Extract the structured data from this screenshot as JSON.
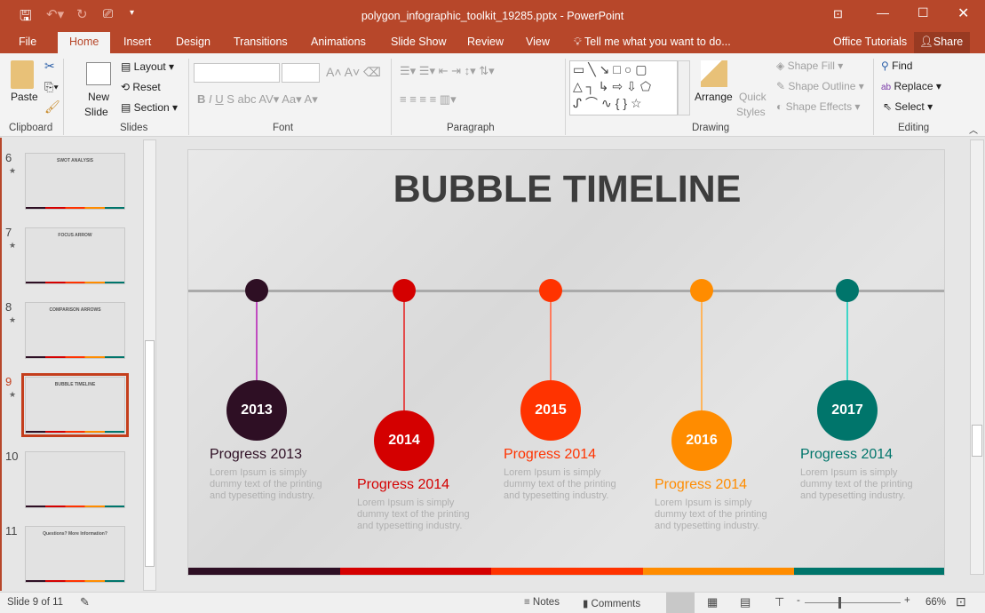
{
  "window": {
    "title": "polygon_infographic_toolkit_19285.pptx - PowerPoint"
  },
  "tabs": [
    "File",
    "Home",
    "Insert",
    "Design",
    "Transitions",
    "Animations",
    "Slide Show",
    "Review",
    "View"
  ],
  "tell_me": "Tell me what you want to do...",
  "account": "Office Tutorials",
  "share": "Share",
  "ribbon": {
    "paste": "Paste",
    "new_slide": "New",
    "new_slide2": "Slide",
    "layout": "Layout",
    "reset": "Reset",
    "section": "Section",
    "groups": [
      "Clipboard",
      "Slides",
      "Font",
      "Paragraph",
      "Drawing",
      "Editing"
    ],
    "arrange": "Arrange",
    "quick_styles": "Quick",
    "quick_styles2": "Styles",
    "shape_fill": "Shape Fill",
    "shape_outline": "Shape Outline",
    "shape_effects": "Shape Effects",
    "find": "Find",
    "replace": "Replace",
    "select": "Select"
  },
  "thumbnails": [
    {
      "num": "6",
      "title": "SWOT ANALYSIS"
    },
    {
      "num": "7",
      "title": "FOCUS ARROW"
    },
    {
      "num": "8",
      "title": "COMPARISON ARROWS"
    },
    {
      "num": "9",
      "title": "BUBBLE TIMELINE"
    },
    {
      "num": "10",
      "title": ""
    },
    {
      "num": "11",
      "title": "Questions? More Information?"
    }
  ],
  "slide": {
    "title": "BUBBLE TIMELINE",
    "items": [
      {
        "year": "2013",
        "heading": "Progress 2013",
        "body": "Lorem Ipsum is simply dummy text of the printing and typesetting industry.",
        "color": "#2e0f24",
        "stem": "#c04cc0"
      },
      {
        "year": "2014",
        "heading": "Progress 2014",
        "body": "Lorem Ipsum is simply dummy text of the printing and typesetting industry.",
        "color": "#d40000",
        "stem": "#e34c4c"
      },
      {
        "year": "2015",
        "heading": "Progress 2014",
        "body": "Lorem Ipsum is simply dummy text of the printing and typesetting industry.",
        "color": "#ff3300",
        "stem": "#ff7a5c"
      },
      {
        "year": "2016",
        "heading": "Progress 2014",
        "body": "Lorem Ipsum is simply dummy text of the printing and typesetting industry.",
        "color": "#ff8c00",
        "stem": "#ffb55c"
      },
      {
        "year": "2017",
        "heading": "Progress 2014",
        "body": "Lorem Ipsum is simply dummy text of the printing and typesetting industry.",
        "color": "#00756b",
        "stem": "#3fd6c8"
      }
    ]
  },
  "status": {
    "slide": "Slide 9 of 11",
    "notes": "Notes",
    "comments": "Comments",
    "zoom": "66%"
  }
}
